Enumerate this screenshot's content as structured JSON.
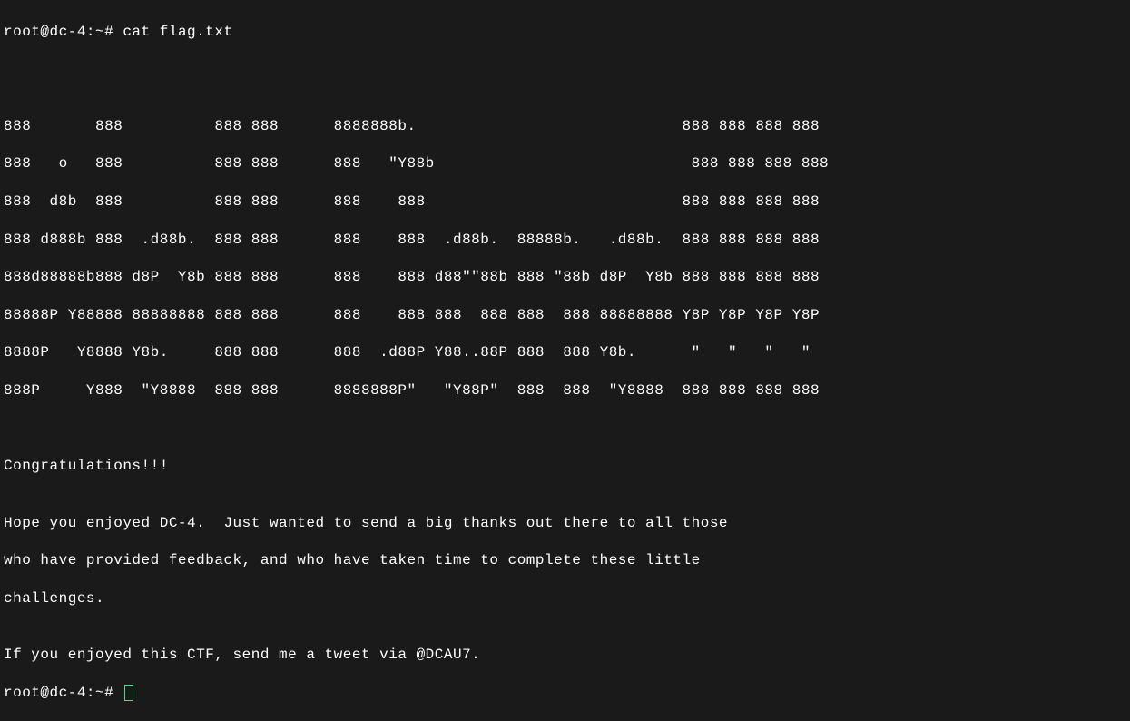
{
  "prompt1": "root@dc-4:~# ",
  "command1": "cat flag.txt",
  "blank": "",
  "ascii_line1": "888       888          888 888      8888888b.                             888 888 888 888",
  "ascii_line2": "888   o   888          888 888      888   \"Y88b                            888 888 888 888",
  "ascii_line3": "888  d8b  888          888 888      888    888                            888 888 888 888",
  "ascii_line4": "888 d888b 888  .d88b.  888 888      888    888  .d88b.  88888b.   .d88b.  888 888 888 888",
  "ascii_line5": "888d88888b888 d8P  Y8b 888 888      888    888 d88\"\"88b 888 \"88b d8P  Y8b 888 888 888 888",
  "ascii_line6": "88888P Y88888 88888888 888 888      888    888 888  888 888  888 88888888 Y8P Y8P Y8P Y8P",
  "ascii_line7": "8888P   Y8888 Y8b.     888 888      888  .d88P Y88..88P 888  888 Y8b.      \"   \"   \"   \" ",
  "ascii_line8": "888P     Y888  \"Y8888  888 888      8888888P\"   \"Y88P\"  888  888  \"Y8888  888 888 888 888",
  "congrats": "Congratulations!!!",
  "msg1": "Hope you enjoyed DC-4.  Just wanted to send a big thanks out there to all those",
  "msg2": "who have provided feedback, and who have taken time to complete these little",
  "msg3": "challenges.",
  "msg4": "If you enjoyed this CTF, send me a tweet via @DCAU7.",
  "prompt2": "root@dc-4:~# "
}
